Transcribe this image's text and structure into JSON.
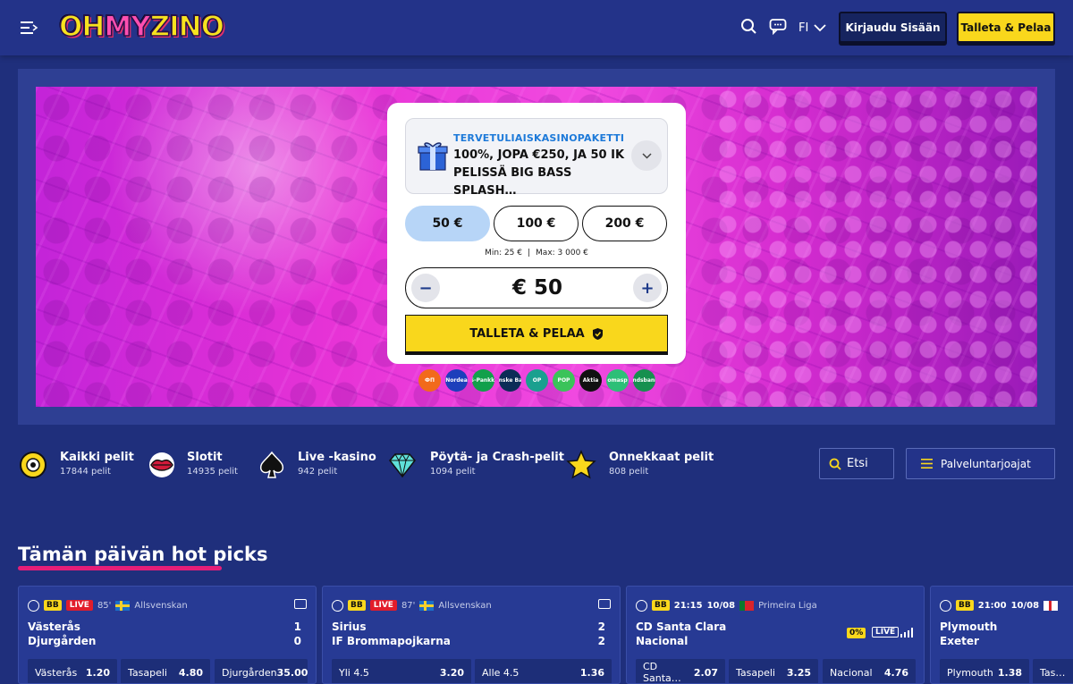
{
  "header": {
    "logo": {
      "pre": "OH",
      "my": "MY",
      "post": "ZINO"
    },
    "language": "FI",
    "login_label": "Kirjaudu Sisään",
    "deposit_label": "Talleta & Pelaa"
  },
  "bonus_card": {
    "tag": "TERVETULIAISKASINOPAKETTI",
    "text": "100%, JOPA €250, JA 50 IK PELISSÄ BIG BASS SPLASH…",
    "amounts": [
      "50 €",
      "100 €",
      "200 €"
    ],
    "selected_amount": "50 €",
    "min_label": "Min: 25 €",
    "max_label": "Max: 3 000 €",
    "value": "€ 50",
    "cta_label": "TALLETA & PELAA"
  },
  "payment_methods": [
    {
      "name": "ФП",
      "color": "#f26a1b"
    },
    {
      "name": "Nordea",
      "color": "#1d3fbb"
    },
    {
      "name": "S-Pankki",
      "color": "#12a04b"
    },
    {
      "name": "Danske Bank",
      "color": "#0b2c57"
    },
    {
      "name": "OP",
      "color": "#1aa08f"
    },
    {
      "name": "POP",
      "color": "#3bc35a"
    },
    {
      "name": "Aktia",
      "color": "#111111"
    },
    {
      "name": "omasp",
      "color": "#2dbf77"
    },
    {
      "name": "Ålandsbanken",
      "color": "#16904f"
    }
  ],
  "categories": [
    {
      "name": "Kaikki pelit",
      "count": "17844 pelit"
    },
    {
      "name": "Slotit",
      "count": "14935 pelit"
    },
    {
      "name": "Live -kasino",
      "count": "942 pelit"
    },
    {
      "name": "Pöytä- ja Crash-pelit",
      "count": "1094 pelit"
    },
    {
      "name": "Onnekkaat pelit",
      "count": "808 pelit"
    }
  ],
  "search": {
    "label": "Etsi"
  },
  "providers_label": "Palveluntarjoajat",
  "hot_picks": {
    "title": "Tämän päivän hot picks",
    "matches": [
      {
        "badge": "BB",
        "live": "LIVE",
        "minute": "85'",
        "league": "Allsvenskan",
        "home": "Västerås",
        "away": "Djurgården",
        "home_score": "1",
        "away_score": "0",
        "odds": [
          {
            "label": "Västerås",
            "value": "1.20"
          },
          {
            "label": "Tasapeli",
            "value": "4.80"
          },
          {
            "label": "Djurgården",
            "value": "35.00"
          }
        ]
      },
      {
        "badge": "BB",
        "live": "LIVE",
        "minute": "87'",
        "league": "Allsvenskan",
        "home": "Sirius",
        "away": "IF Brommapojkarna",
        "home_score": "2",
        "away_score": "2",
        "odds": [
          {
            "label": "Yli 4.5",
            "value": "3.20"
          },
          {
            "label": "Alle 4.5",
            "value": "1.36"
          }
        ]
      },
      {
        "badge": "BB",
        "time": "21:15",
        "date": "10/08",
        "league": "Primeira Liga",
        "home": "CD Santa Clara",
        "away": "Nacional",
        "pct": "0%",
        "live_label": "LIVE",
        "odds": [
          {
            "label": "CD Santa…",
            "value": "2.07"
          },
          {
            "label": "Tasapeli",
            "value": "3.25"
          },
          {
            "label": "Nacional",
            "value": "4.76"
          }
        ]
      },
      {
        "badge": "BB",
        "time": "21:00",
        "date": "10/08",
        "home": "Plymouth",
        "away": "Exeter",
        "odds": [
          {
            "label": "Plymouth",
            "value": "1.38"
          },
          {
            "label": "Tas…",
            "value": ""
          }
        ]
      }
    ]
  }
}
